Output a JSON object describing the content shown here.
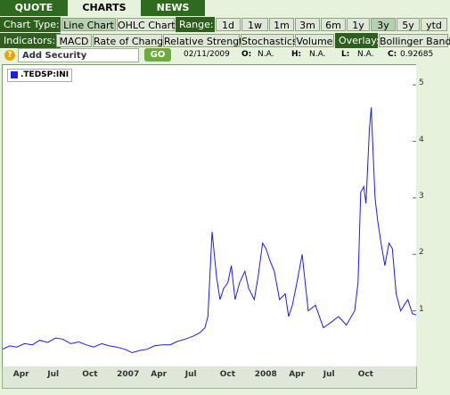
{
  "tabs": [
    "QUOTE",
    "CHARTS",
    "NEWS"
  ],
  "chart_type_label": "Chart Type:",
  "chart_types": [
    "Line Chart",
    "OHLC Chart"
  ],
  "range_label": "Range:",
  "ranges": [
    "1d",
    "1w",
    "1m",
    "3m",
    "6m",
    "1y",
    "3y",
    "5y",
    "ytd"
  ],
  "selected_range": "3y",
  "indicators_label": "Indicators:",
  "indicators": [
    "MACD",
    "Rate of Change",
    "Relative Strength",
    "Stochastics",
    "Volume"
  ],
  "overlay_label": "Overlay:",
  "overlay_option": "Bollinger Bands",
  "search": {
    "value": "Add Security",
    "go_label": "GO"
  },
  "quote": {
    "date": "02/11/2009",
    "open_label": "O:",
    "open": "N.A.",
    "high_label": "H:",
    "high": "N.A.",
    "low_label": "L:",
    "low": "N.A.",
    "close_label": "C:",
    "close": "0.92685"
  },
  "chart_data": {
    "type": "line",
    "legend": [
      ".TEDSP:INI"
    ],
    "x_tick_labels": [
      "Apr",
      "Jul",
      "Oct",
      "2007",
      "Apr",
      "Jul",
      "Oct",
      "2008",
      "Apr",
      "Jul",
      "Oct"
    ],
    "y_tick_labels": [
      "1",
      "2",
      "3",
      "4",
      "5"
    ],
    "ylim": [
      0,
      5.35
    ],
    "series": [
      {
        "color": "#1d1de6",
        "x": [
          "2006-02-11",
          "2006-03-01",
          "2006-03-20",
          "2006-04-10",
          "2006-05-01",
          "2006-05-20",
          "2006-06-10",
          "2006-07-01",
          "2006-07-20",
          "2006-08-10",
          "2006-09-01",
          "2006-09-20",
          "2006-10-10",
          "2006-11-01",
          "2006-11-20",
          "2006-12-10",
          "2007-01-01",
          "2007-01-20",
          "2007-02-10",
          "2007-03-01",
          "2007-03-20",
          "2007-04-10",
          "2007-05-01",
          "2007-05-20",
          "2007-06-10",
          "2007-07-01",
          "2007-07-20",
          "2007-08-01",
          "2007-08-09",
          "2007-08-20",
          "2007-09-01",
          "2007-09-10",
          "2007-09-20",
          "2007-10-01",
          "2007-10-10",
          "2007-10-20",
          "2007-11-01",
          "2007-11-15",
          "2007-11-25",
          "2007-12-10",
          "2007-12-20",
          "2008-01-01",
          "2008-01-10",
          "2008-01-20",
          "2008-02-01",
          "2008-02-15",
          "2008-03-01",
          "2008-03-10",
          "2008-03-20",
          "2008-04-01",
          "2008-04-15",
          "2008-05-01",
          "2008-05-20",
          "2008-06-10",
          "2008-07-01",
          "2008-07-20",
          "2008-08-10",
          "2008-09-01",
          "2008-09-10",
          "2008-09-17",
          "2008-09-25",
          "2008-10-01",
          "2008-10-10",
          "2008-10-15",
          "2008-10-20",
          "2008-10-25",
          "2008-11-01",
          "2008-11-10",
          "2008-11-20",
          "2008-12-01",
          "2008-12-10",
          "2008-12-20",
          "2009-01-01",
          "2009-01-10",
          "2009-01-20",
          "2009-02-01",
          "2009-02-11"
        ],
        "y": [
          0.32,
          0.38,
          0.36,
          0.42,
          0.4,
          0.48,
          0.44,
          0.52,
          0.5,
          0.42,
          0.45,
          0.4,
          0.36,
          0.42,
          0.38,
          0.36,
          0.32,
          0.26,
          0.3,
          0.32,
          0.38,
          0.4,
          0.4,
          0.46,
          0.5,
          0.55,
          0.62,
          0.7,
          0.9,
          2.4,
          1.6,
          1.2,
          1.4,
          1.5,
          1.8,
          1.2,
          1.5,
          1.7,
          1.4,
          1.2,
          1.6,
          2.2,
          2.1,
          1.9,
          1.7,
          1.2,
          1.3,
          0.9,
          1.1,
          1.5,
          2.0,
          1.0,
          1.1,
          0.7,
          0.8,
          0.9,
          0.75,
          1.0,
          1.5,
          3.1,
          3.2,
          2.9,
          4.2,
          4.6,
          3.8,
          3.0,
          2.6,
          2.2,
          1.8,
          2.2,
          2.1,
          1.3,
          1.0,
          1.1,
          1.2,
          0.95,
          0.93
        ]
      }
    ]
  }
}
